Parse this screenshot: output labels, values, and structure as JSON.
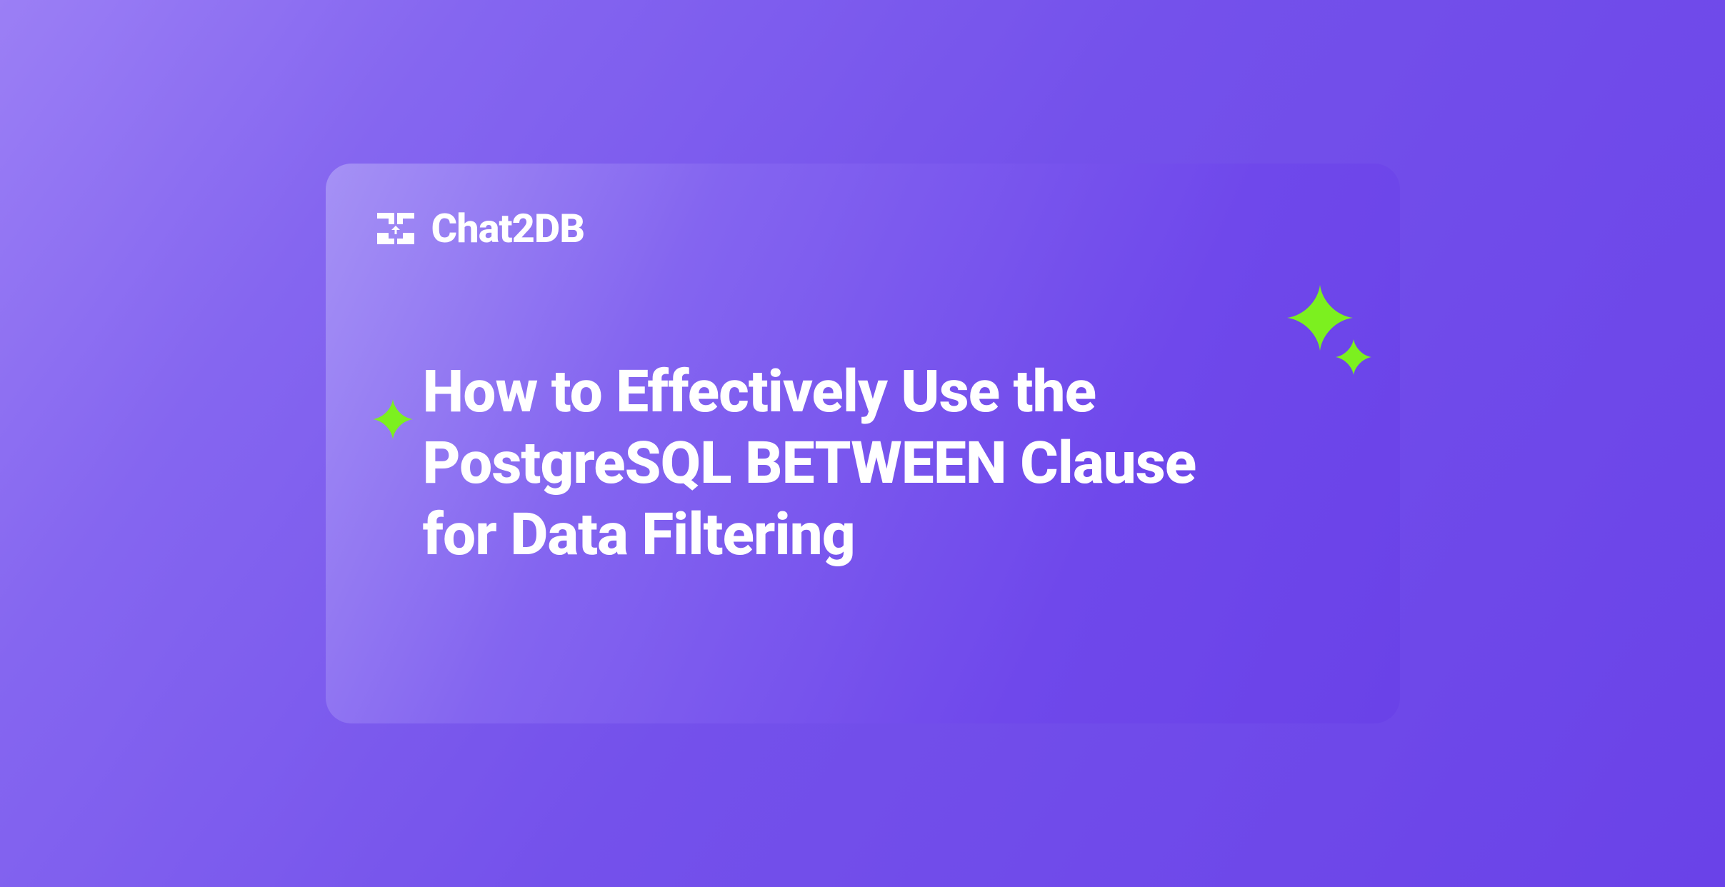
{
  "brand": {
    "name": "Chat2DB"
  },
  "headline": "How to Effectively Use the PostgreSQL BETWEEN Clause for Data Filtering",
  "colors": {
    "background_start": "#9b7ff5",
    "background_end": "#6a42e8",
    "accent_sparkle": "#7cf01f",
    "text": "#ffffff"
  }
}
